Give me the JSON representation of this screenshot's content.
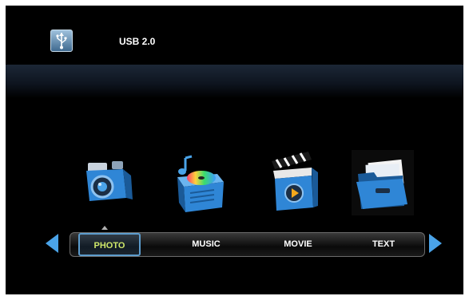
{
  "device": {
    "title": "USB 2.0",
    "icon": "usb-drive-icon"
  },
  "categories": [
    {
      "label": "PHOTO",
      "icon": "camera-icon",
      "selected": true
    },
    {
      "label": "MUSIC",
      "icon": "music-disc-icon",
      "selected": false
    },
    {
      "label": "MOVIE",
      "icon": "clapperboard-icon",
      "selected": false
    },
    {
      "label": "TEXT",
      "icon": "folder-icon",
      "selected": false
    }
  ],
  "colors": {
    "accent": "#4aa3e8",
    "selected_text": "#cfe86a",
    "background": "#000000"
  }
}
